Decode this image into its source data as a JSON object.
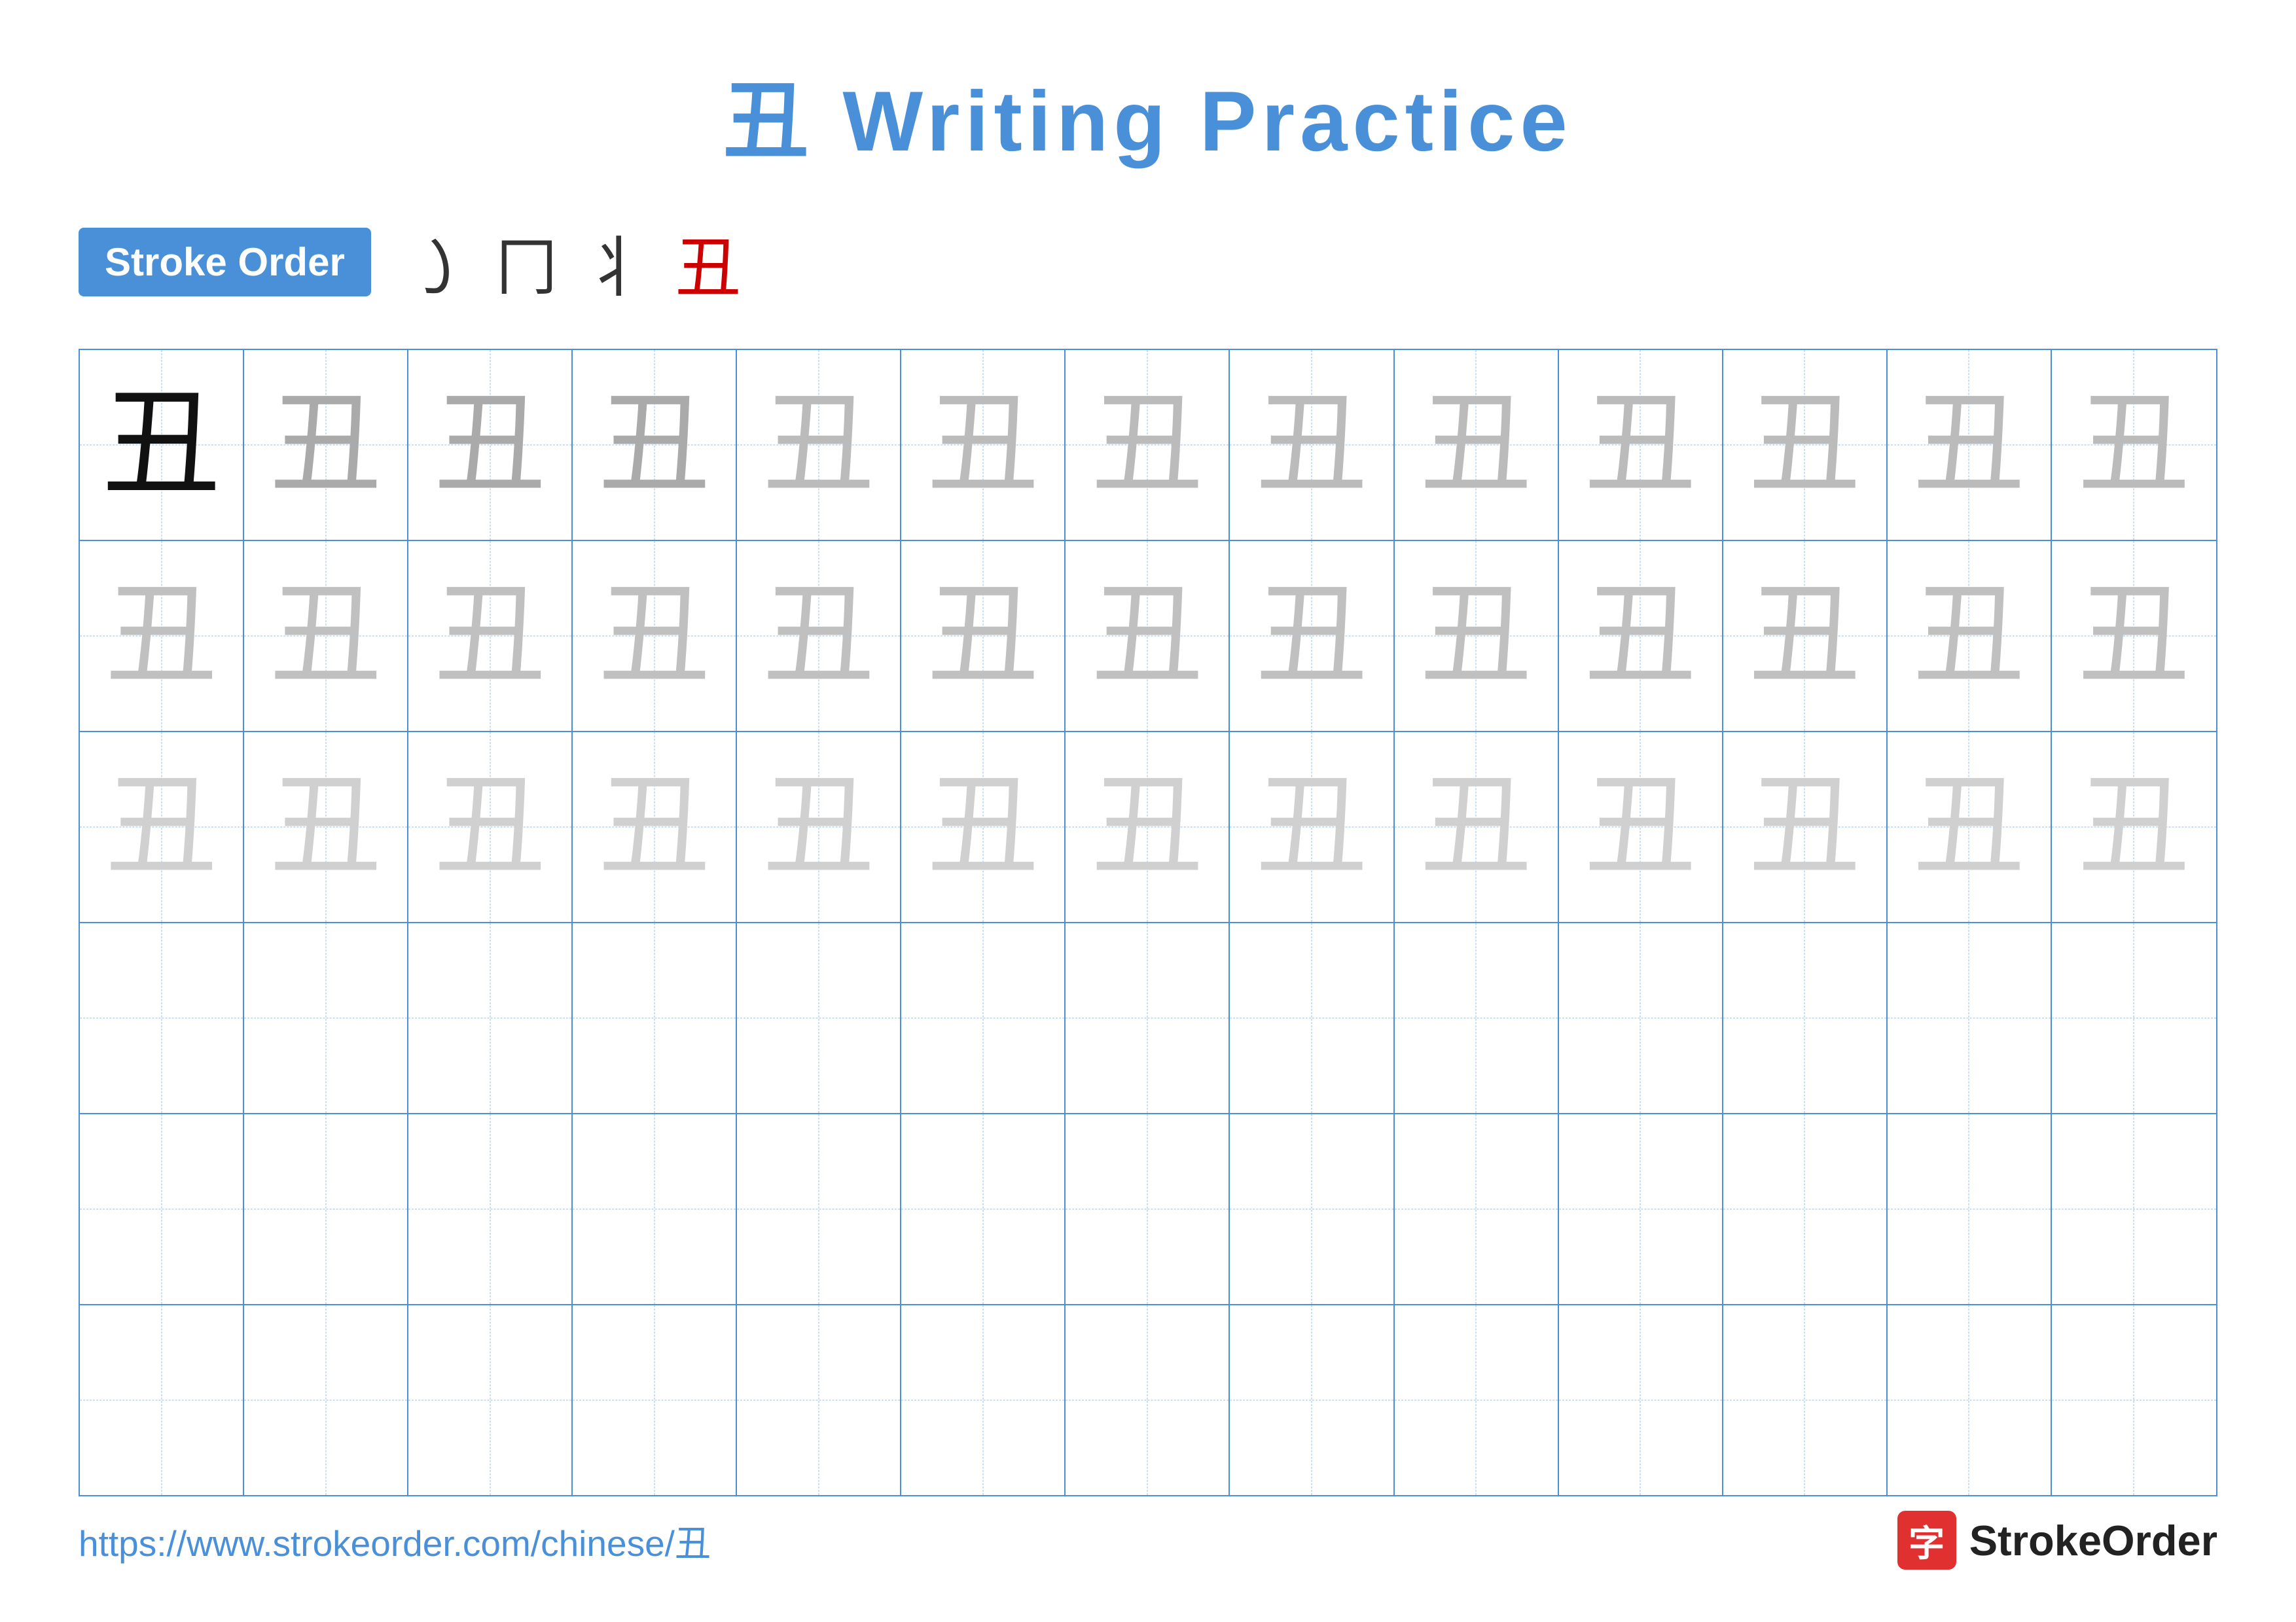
{
  "title": {
    "character": "丑",
    "text": "Writing Practice",
    "full": "丑 Writing Practice"
  },
  "stroke_order": {
    "badge_label": "Stroke Order",
    "steps": [
      "㇀",
      "冂",
      "丬",
      "丑"
    ]
  },
  "grid": {
    "rows": 6,
    "cols": 13,
    "char": "丑",
    "row_configs": [
      {
        "type": "dark_then_light1"
      },
      {
        "type": "light2"
      },
      {
        "type": "light3"
      },
      {
        "type": "empty"
      },
      {
        "type": "empty"
      },
      {
        "type": "empty"
      }
    ]
  },
  "footer": {
    "url": "https://www.strokeorder.com/chinese/丑",
    "brand": "StrokeOrder",
    "logo_char": "字"
  }
}
